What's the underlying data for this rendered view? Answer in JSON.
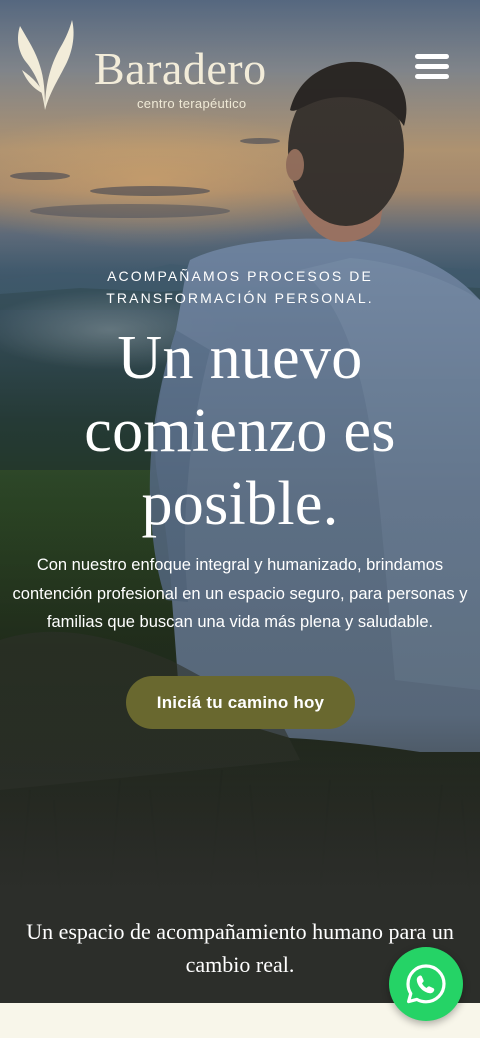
{
  "brand": {
    "name": "Baradero",
    "tagline": "centro terapéutico",
    "logo_icon": "leaf-icon",
    "logo_color": "#f2ecd9"
  },
  "header": {
    "menu_icon": "hamburger-menu-icon"
  },
  "hero": {
    "eyebrow": "ACOMPAÑAMOS PROCESOS DE TRANSFORMACIÓN PERSONAL.",
    "headline": "Un nuevo comienzo es posible.",
    "description": "Con nuestro enfoque integral y humanizado, brindamos contención profesional en un espacio seguro, para personas y familias que buscan una vida más plena y saludable.",
    "cta_label": "Iniciá tu camino hoy",
    "cta_color": "#69682f",
    "image": "person-sitting-on-hill-at-sunset"
  },
  "section": {
    "title": "Un espacio de acompañamiento humano para un cambio real.",
    "background": "#2c2e2a"
  },
  "whatsapp": {
    "icon": "whatsapp-icon",
    "color": "#25d366"
  }
}
